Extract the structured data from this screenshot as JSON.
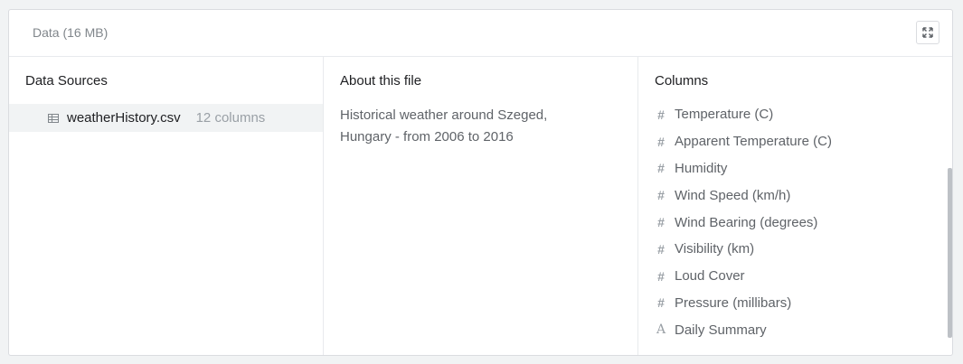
{
  "panel": {
    "title": "Data (16 MB)"
  },
  "data_sources": {
    "heading": "Data Sources",
    "items": [
      {
        "name": "weatherHistory.csv",
        "columns": "12 columns",
        "icon": "table-icon"
      }
    ]
  },
  "about": {
    "heading": "About this file",
    "description_line1": "Historical weather around Szeged,",
    "description_line2": "Hungary - from 2006 to 2016"
  },
  "columns": {
    "heading": "Columns",
    "items": [
      {
        "name": "Temperature (C)",
        "type": "numeric",
        "icon": "#"
      },
      {
        "name": "Apparent Temperature (C)",
        "type": "numeric",
        "icon": "#"
      },
      {
        "name": "Humidity",
        "type": "numeric",
        "icon": "#"
      },
      {
        "name": "Wind Speed (km/h)",
        "type": "numeric",
        "icon": "#"
      },
      {
        "name": "Wind Bearing (degrees)",
        "type": "numeric",
        "icon": "#"
      },
      {
        "name": "Visibility (km)",
        "type": "numeric",
        "icon": "#"
      },
      {
        "name": "Loud Cover",
        "type": "numeric",
        "icon": "#"
      },
      {
        "name": "Pressure (millibars)",
        "type": "numeric",
        "icon": "#"
      },
      {
        "name": "Daily Summary",
        "type": "string",
        "icon": "A"
      }
    ]
  }
}
